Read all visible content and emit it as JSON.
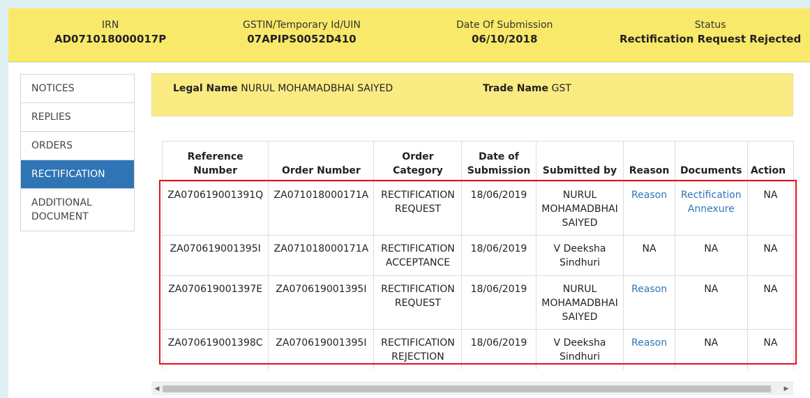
{
  "header": {
    "irn_label": "IRN",
    "irn_value": "AD071018000017P",
    "gstin_label": "GSTIN/Temporary Id/UIN",
    "gstin_value": "07APIPS0052D410",
    "date_label": "Date Of Submission",
    "date_value": "06/10/2018",
    "status_label": "Status",
    "status_value": "Rectification Request Rejected"
  },
  "sidebar": {
    "items": [
      {
        "label": "NOTICES"
      },
      {
        "label": "REPLIES"
      },
      {
        "label": "ORDERS"
      },
      {
        "label": "RECTIFICATION"
      },
      {
        "label": "ADDITIONAL DOCUMENT"
      }
    ],
    "active": "RECTIFICATION"
  },
  "names": {
    "legal_label": "Legal Name",
    "legal_value": "NURUL MOHAMADBHAI SAIYED",
    "trade_label": "Trade Name",
    "trade_value": "GST"
  },
  "table": {
    "headers": [
      "Reference Number",
      "Order Number",
      "Order Category",
      "Date of Submission",
      "Submitted by",
      "Reason",
      "Documents",
      "Action"
    ],
    "rows": [
      {
        "ref": "ZA070619001391Q",
        "order": "ZA071018000171A",
        "category": "RECTIFICATION REQUEST",
        "date": "18/06/2019",
        "by": "NURUL MOHAMADBHAI SAIYED",
        "reason": "Reason",
        "documents": "Rectification Annexure",
        "action": "NA"
      },
      {
        "ref": "ZA070619001395I",
        "order": "ZA071018000171A",
        "category": "RECTIFICATION ACCEPTANCE",
        "date": "18/06/2019",
        "by": "V Deeksha Sindhuri",
        "reason": "NA",
        "documents": "NA",
        "action": "NA"
      },
      {
        "ref": "ZA070619001397E",
        "order": "ZA070619001395I",
        "category": "RECTIFICATION REQUEST",
        "date": "18/06/2019",
        "by": "NURUL MOHAMADBHAI SAIYED",
        "reason": "Reason",
        "documents": "NA",
        "action": "NA"
      },
      {
        "ref": "ZA070619001398C",
        "order": "ZA070619001395I",
        "category": "RECTIFICATION REJECTION",
        "date": "18/06/2019",
        "by": "V Deeksha Sindhuri",
        "reason": "Reason",
        "documents": "NA",
        "action": "NA"
      }
    ]
  },
  "colors": {
    "header_bg": "#f9e96a",
    "active_tab": "#2f75b5",
    "link": "#2f75b5",
    "highlight_border": "#e3121c"
  },
  "icons": {
    "scroll_left": "scroll-left-arrow-icon",
    "scroll_right": "scroll-right-arrow-icon"
  }
}
